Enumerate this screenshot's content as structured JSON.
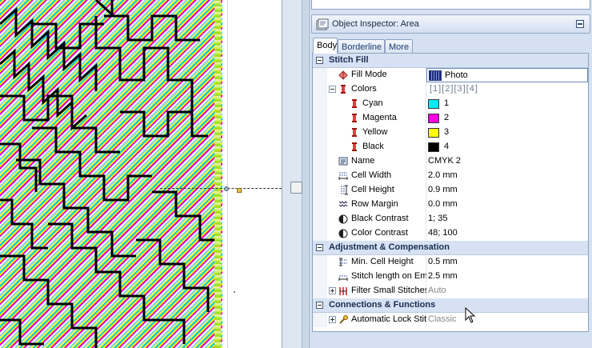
{
  "inspector": {
    "title": "Object Inspector: Area",
    "tabs": [
      {
        "label": "Body",
        "active": true
      },
      {
        "label": "Borderline",
        "active": false
      },
      {
        "label": "More",
        "active": false
      }
    ],
    "sections": {
      "stitch_fill": {
        "title": "Stitch Fill",
        "fill_mode": {
          "label": "Fill Mode",
          "value": "Photo"
        },
        "colors": {
          "label": "Colors",
          "palette": "[1][2][3][4]"
        },
        "cyan": {
          "label": "Cyan",
          "value": "1",
          "color": "#00e8f0"
        },
        "magenta": {
          "label": "Magenta",
          "value": "2",
          "color": "#ff00e0"
        },
        "yellow": {
          "label": "Yellow",
          "value": "3",
          "color": "#ffff00"
        },
        "black": {
          "label": "Black",
          "value": "4",
          "color": "#000000"
        },
        "name": {
          "label": "Name",
          "value": "CMYK 2"
        },
        "cell_width": {
          "label": "Cell Width",
          "value": "2.0 mm"
        },
        "cell_height": {
          "label": "Cell Height",
          "value": "0.9 mm"
        },
        "row_margin": {
          "label": "Row Margin",
          "value": "0.0 mm"
        },
        "black_contrast": {
          "label": "Black Contrast",
          "value": "1; 35"
        },
        "color_contrast": {
          "label": "Color Contrast",
          "value": "48; 100"
        }
      },
      "adjustment": {
        "title": "Adjustment & Compensation",
        "min_cell_height": {
          "label": "Min. Cell Height",
          "value": "0.5 mm"
        },
        "stitch_length": {
          "label": "Stitch length on Em",
          "value": "2.5 mm"
        },
        "filter_small": {
          "label": "Filter Small Stitches",
          "value": "Auto"
        }
      },
      "connections": {
        "title": "Connections & Functions",
        "auto_lock": {
          "label": "Automatic Lock Stit",
          "value": "Classic"
        }
      }
    }
  }
}
